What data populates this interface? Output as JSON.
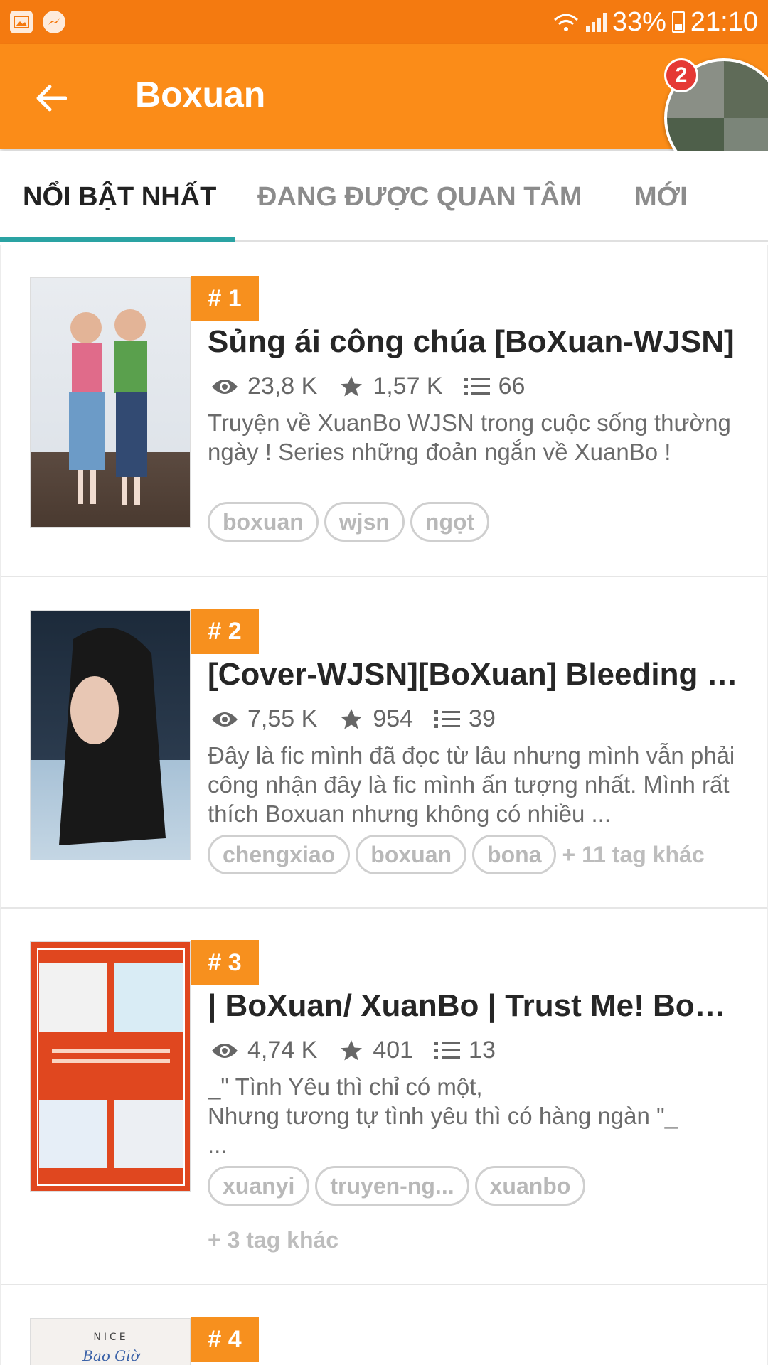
{
  "status_bar": {
    "battery": "33%",
    "time": "21:10"
  },
  "app_bar": {
    "title": "Boxuan",
    "notification_count": "2"
  },
  "tabs": [
    {
      "label": "NỔI BẬT NHẤT"
    },
    {
      "label": "ĐANG ĐƯỢC QUAN TÂM"
    },
    {
      "label": "MỚI"
    }
  ],
  "stories": [
    {
      "rank": "# 1",
      "title": "Sủng ái công chúa [BoXuan-WJSN]",
      "views": "23,8 K",
      "votes": "1,57 K",
      "parts": "66",
      "description": "Truyện về XuanBo WJSN trong cuộc sống thường ngày ! Series những đoản ngắn về XuanBo !",
      "tags": [
        "boxuan",
        "wjsn",
        "ngọt"
      ],
      "more_tags": ""
    },
    {
      "rank": "# 2",
      "title": "[Cover-WJSN][BoXuan] Bleeding L...",
      "views": "7,55 K",
      "votes": "954",
      "parts": "39",
      "description": "Đây là fic mình đã đọc từ lâu nhưng mình vẫn phải công nhận đây là fic mình ấn tượng nhất. Mình rất thích Boxuan nhưng không có nhiều ...",
      "tags": [
        "chengxiao",
        "boxuan",
        "bona"
      ],
      "more_tags": "+ 11 tag khác"
    },
    {
      "rank": "# 3",
      "title": "| BoXuan/ XuanBo | Trust Me! BoX...",
      "views": "4,74 K",
      "votes": "401",
      "parts": "13",
      "description": "_\" Tình Yêu thì chỉ có một,\nNhưng tương tự tình yêu thì có hàng ngàn \"_\n...",
      "tags": [
        "xuanyi",
        "truyen-ng...",
        "xuanbo"
      ],
      "more_tags": "+ 3 tag khác"
    },
    {
      "rank": "# 4",
      "cover_text_1": "NICE",
      "cover_text_2": "Bao Giờ"
    }
  ],
  "colors": {
    "status_bar": "#f47a10",
    "app_bar": "#fb8c18",
    "rank_badge": "#f7901e",
    "tab_indicator": "#2aa3a3"
  }
}
